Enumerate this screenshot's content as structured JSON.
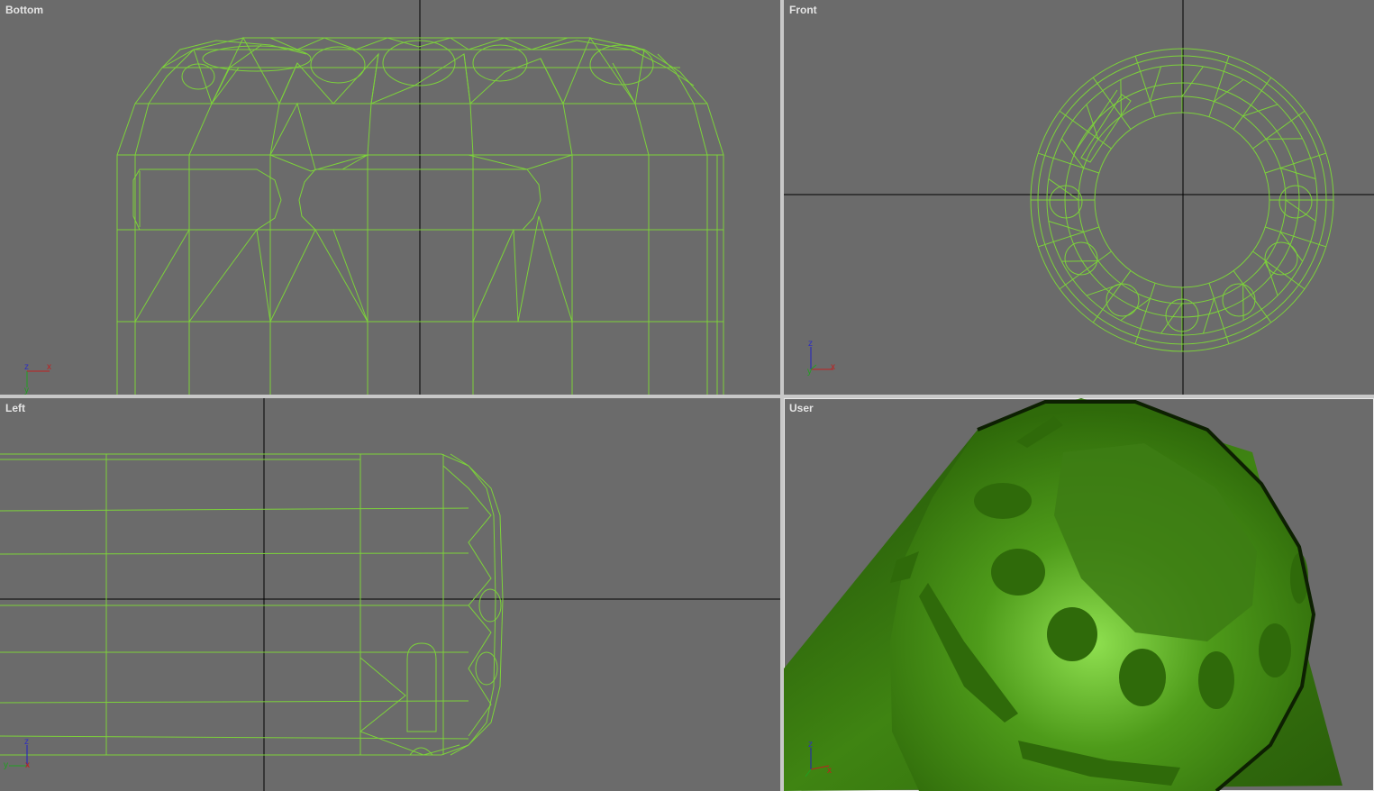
{
  "viewports": {
    "bottom": {
      "label": "Bottom",
      "axis": {
        "up": "z",
        "right": "x",
        "down": "y"
      }
    },
    "front": {
      "label": "Front",
      "axis": {
        "up": "z",
        "right": "x",
        "corner": "y"
      }
    },
    "left": {
      "label": "Left",
      "axis": {
        "up": "z",
        "right": "x",
        "left": "y"
      }
    },
    "user": {
      "label": "User",
      "axis": {
        "up": "z",
        "right": "x"
      }
    }
  },
  "colors": {
    "viewport_bg": "#6b6b6b",
    "wire": "#7cd23a",
    "grid_axis": "#000000",
    "axis_x": "#c02020",
    "axis_y": "#20a020",
    "axis_z": "#2020c0",
    "shaded_dark": "#2f6a0a",
    "shaded_light": "#8fe050"
  }
}
